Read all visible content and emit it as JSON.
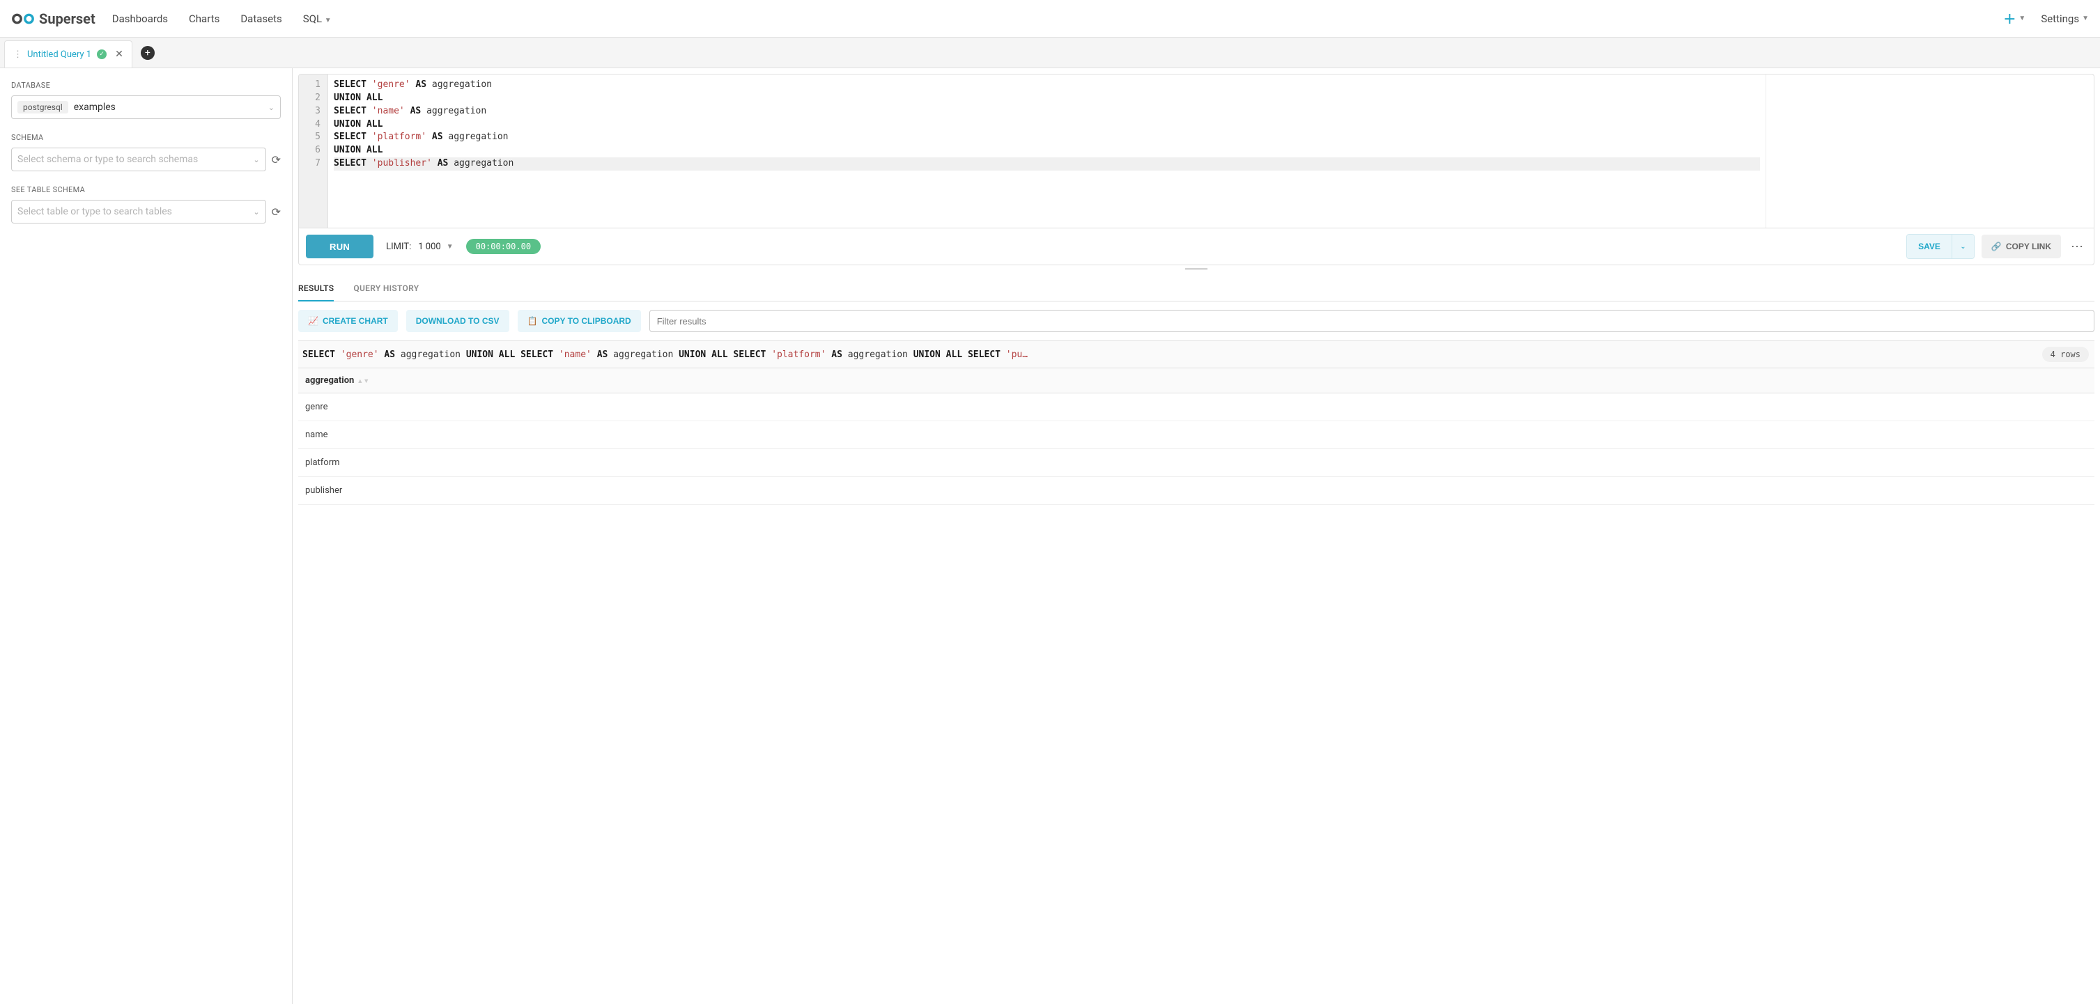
{
  "nav": {
    "brand": "Superset",
    "links": [
      "Dashboards",
      "Charts",
      "Datasets",
      "SQL"
    ],
    "settings": "Settings"
  },
  "tab": {
    "name": "Untitled Query 1",
    "status": "success"
  },
  "leftPane": {
    "database": {
      "label": "DATABASE",
      "pill": "postgresql",
      "value": "examples"
    },
    "schema": {
      "label": "SCHEMA",
      "placeholder": "Select schema or type to search schemas"
    },
    "table": {
      "label": "SEE TABLE SCHEMA",
      "placeholder": "Select table or type to search tables"
    }
  },
  "editor": {
    "lines": [
      [
        {
          "t": "SELECT",
          "c": "kw"
        },
        {
          "t": " "
        },
        {
          "t": "'genre'",
          "c": "str"
        },
        {
          "t": " "
        },
        {
          "t": "AS",
          "c": "kw"
        },
        {
          "t": " aggregation",
          "c": "ident"
        }
      ],
      [
        {
          "t": "UNION",
          "c": "kw"
        },
        {
          "t": " "
        },
        {
          "t": "ALL",
          "c": "kw"
        }
      ],
      [
        {
          "t": "SELECT",
          "c": "kw"
        },
        {
          "t": " "
        },
        {
          "t": "'name'",
          "c": "str"
        },
        {
          "t": " "
        },
        {
          "t": "AS",
          "c": "kw"
        },
        {
          "t": " aggregation",
          "c": "ident"
        }
      ],
      [
        {
          "t": "UNION",
          "c": "kw"
        },
        {
          "t": " "
        },
        {
          "t": "ALL",
          "c": "kw"
        }
      ],
      [
        {
          "t": "SELECT",
          "c": "kw"
        },
        {
          "t": " "
        },
        {
          "t": "'platform'",
          "c": "str"
        },
        {
          "t": " "
        },
        {
          "t": "AS",
          "c": "kw"
        },
        {
          "t": " aggregation",
          "c": "ident"
        }
      ],
      [
        {
          "t": "UNION",
          "c": "kw"
        },
        {
          "t": " "
        },
        {
          "t": "ALL",
          "c": "kw"
        }
      ],
      [
        {
          "t": "SELECT",
          "c": "kw"
        },
        {
          "t": " "
        },
        {
          "t": "'publisher'",
          "c": "str"
        },
        {
          "t": " "
        },
        {
          "t": "AS",
          "c": "kw"
        },
        {
          "t": " aggregation",
          "c": "ident"
        }
      ]
    ],
    "activeLine": 7
  },
  "toolbar": {
    "run": "RUN",
    "limitLabel": "LIMIT:",
    "limitValue": "1 000",
    "timer": "00:00:00.00",
    "save": "SAVE",
    "copyLink": "COPY LINK"
  },
  "resultsTabs": {
    "results": "RESULTS",
    "history": "QUERY HISTORY",
    "active": "results"
  },
  "resultsActions": {
    "createChart": "CREATE CHART",
    "downloadCsv": "DOWNLOAD TO CSV",
    "copyClipboard": "COPY TO CLIPBOARD",
    "filterPlaceholder": "Filter results"
  },
  "sqlOneLiner": {
    "tokens": [
      {
        "t": "SELECT",
        "c": "kw"
      },
      {
        "t": " "
      },
      {
        "t": "'genre'",
        "c": "str"
      },
      {
        "t": " "
      },
      {
        "t": "AS",
        "c": "kw"
      },
      {
        "t": " aggregation ",
        "c": "ident"
      },
      {
        "t": "UNION",
        "c": "kw"
      },
      {
        "t": " "
      },
      {
        "t": "ALL",
        "c": "kw"
      },
      {
        "t": " "
      },
      {
        "t": "SELECT",
        "c": "kw"
      },
      {
        "t": " "
      },
      {
        "t": "'name'",
        "c": "str"
      },
      {
        "t": " "
      },
      {
        "t": "AS",
        "c": "kw"
      },
      {
        "t": " aggregation ",
        "c": "ident"
      },
      {
        "t": "UNION",
        "c": "kw"
      },
      {
        "t": " "
      },
      {
        "t": "ALL",
        "c": "kw"
      },
      {
        "t": " "
      },
      {
        "t": "SELECT",
        "c": "kw"
      },
      {
        "t": " "
      },
      {
        "t": "'platform'",
        "c": "str"
      },
      {
        "t": " "
      },
      {
        "t": "AS",
        "c": "kw"
      },
      {
        "t": " aggregation ",
        "c": "ident"
      },
      {
        "t": "UNION",
        "c": "kw"
      },
      {
        "t": " "
      },
      {
        "t": "ALL",
        "c": "kw"
      },
      {
        "t": " "
      },
      {
        "t": "SELECT",
        "c": "kw"
      },
      {
        "t": " "
      },
      {
        "t": "'pu…",
        "c": "str"
      }
    ],
    "rowCount": "4 rows"
  },
  "resultsTable": {
    "columns": [
      "aggregation"
    ],
    "rows": [
      [
        "genre"
      ],
      [
        "name"
      ],
      [
        "platform"
      ],
      [
        "publisher"
      ]
    ]
  }
}
